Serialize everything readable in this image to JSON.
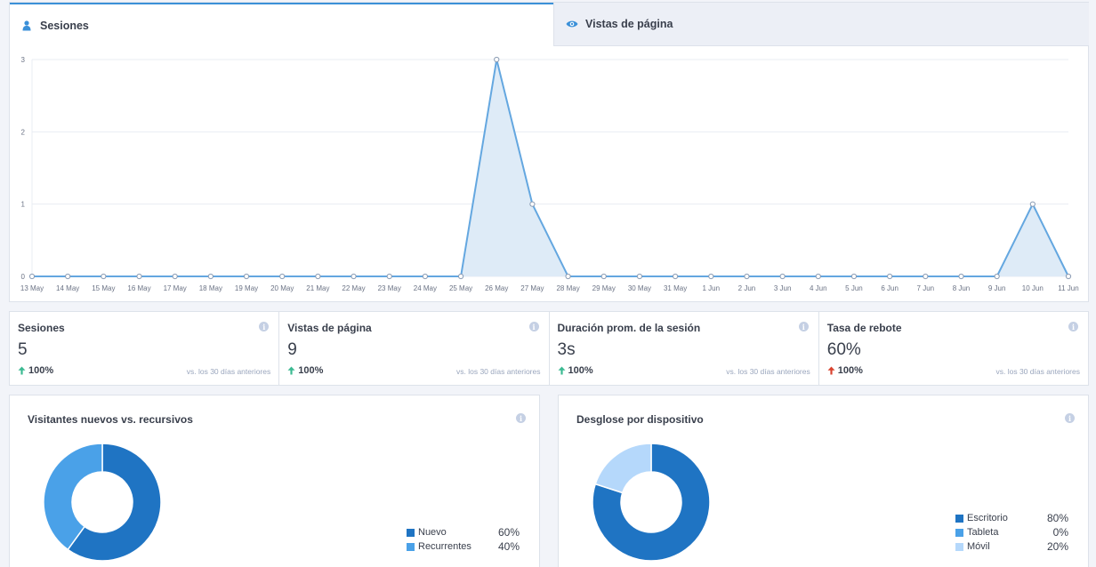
{
  "tabs": [
    {
      "label": "Sesiones",
      "icon": "user-icon",
      "active": true
    },
    {
      "label": "Vistas de página",
      "icon": "eye-icon",
      "active": false
    }
  ],
  "chart_data": {
    "type": "area",
    "x": [
      "13 May",
      "14 May",
      "15 May",
      "16 May",
      "17 May",
      "18 May",
      "19 May",
      "20 May",
      "21 May",
      "22 May",
      "23 May",
      "24 May",
      "25 May",
      "26 May",
      "27 May",
      "28 May",
      "29 May",
      "30 May",
      "31 May",
      "1 Jun",
      "2 Jun",
      "3 Jun",
      "4 Jun",
      "5 Jun",
      "6 Jun",
      "7 Jun",
      "8 Jun",
      "9 Jun",
      "10 Jun",
      "11 Jun"
    ],
    "values": [
      0,
      0,
      0,
      0,
      0,
      0,
      0,
      0,
      0,
      0,
      0,
      0,
      0,
      3,
      1,
      0,
      0,
      0,
      0,
      0,
      0,
      0,
      0,
      0,
      0,
      0,
      0,
      0,
      1,
      0
    ],
    "yticks": [
      0,
      1,
      2,
      3
    ],
    "ylim": [
      0,
      3
    ],
    "grid": true,
    "color": "#64a7e0",
    "fill": "#deebf7"
  },
  "stats": [
    {
      "title": "Sesiones",
      "value": "5",
      "change": "100%",
      "direction": "up",
      "compare": "vs. los 30 días anteriores"
    },
    {
      "title": "Vistas de página",
      "value": "9",
      "change": "100%",
      "direction": "up",
      "compare": "vs. los 30 días anteriores"
    },
    {
      "title": "Duración prom. de la sesión",
      "value": "3s",
      "change": "100%",
      "direction": "up",
      "compare": "vs. los 30 días anteriores"
    },
    {
      "title": "Tasa de rebote",
      "value": "60%",
      "change": "100%",
      "direction": "up-bad",
      "compare": "vs. los 30 días anteriores"
    }
  ],
  "visitors_panel": {
    "title": "Visitantes nuevos vs. recursivos",
    "slices": [
      {
        "label": "Nuevo",
        "value": "60%",
        "fraction": 0.6,
        "color": "#1f74c3"
      },
      {
        "label": "Recurrentes",
        "value": "40%",
        "fraction": 0.4,
        "color": "#4aa1e8"
      }
    ]
  },
  "device_panel": {
    "title": "Desglose por dispositivo",
    "slices": [
      {
        "label": "Escritorio",
        "value": "80%",
        "fraction": 0.8,
        "color": "#1f74c3"
      },
      {
        "label": "Tableta",
        "value": "0%",
        "fraction": 0.0,
        "color": "#4aa1e8"
      },
      {
        "label": "Móvil",
        "value": "20%",
        "fraction": 0.2,
        "color": "#b5d8fb"
      }
    ]
  },
  "colors": {
    "up_good": "#3cba92",
    "up_bad": "#d9432f",
    "info": "#c5d0e4"
  },
  "info_glyph": "i"
}
